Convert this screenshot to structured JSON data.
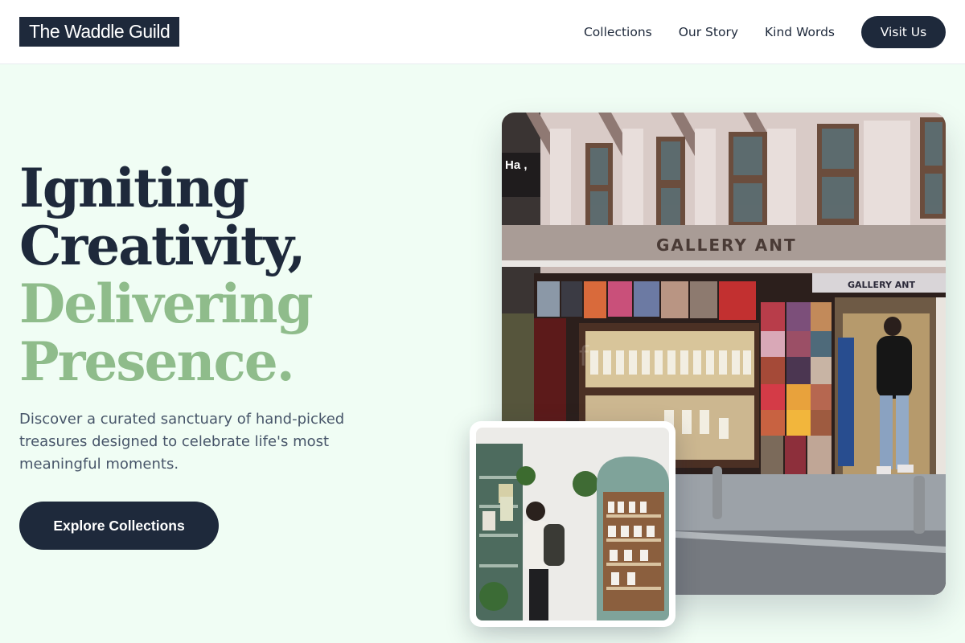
{
  "brand": {
    "name": "The Waddle Guild"
  },
  "nav": {
    "links": [
      "Collections",
      "Our Story",
      "Kind Words"
    ],
    "cta_label": "Visit Us"
  },
  "hero": {
    "headline_line1": "Igniting",
    "headline_line2": "Creativity,",
    "headline_line3": "Delivering",
    "headline_line4": "Presence.",
    "subtext": "Discover a curated sanctuary of hand-picked treasures designed to celebrate life's most meaningful moments.",
    "cta_label": "Explore Collections"
  },
  "images": {
    "main_sign_text": "GALLERY ANT",
    "main_small_sign_text": "GALLERY ANT",
    "main_corner_sign_text": "Ha ,"
  },
  "colors": {
    "primary": "#1e293b",
    "accent_green": "#8fbc8b",
    "background": "#f0fdf4",
    "body_text": "#475569"
  }
}
